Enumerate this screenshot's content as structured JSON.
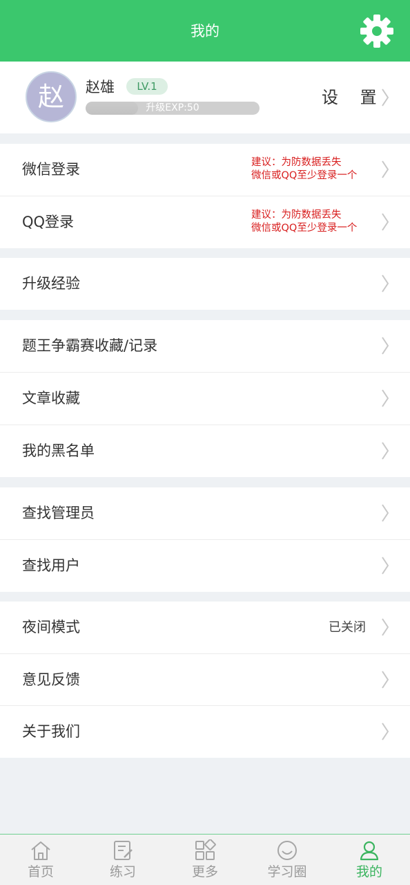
{
  "header": {
    "title": "我的",
    "icon": "gear-icon"
  },
  "profile": {
    "avatar_char": "赵",
    "name": "赵雄",
    "level": "LV.1",
    "exp_text": "升级EXP:50",
    "exp_progress": 0.3,
    "settings_label": "设 置"
  },
  "sections": {
    "wechat_login": {
      "label": "微信登录",
      "hint_line1": "建议：为防数据丢失",
      "hint_line2": "微信或QQ至少登录一个"
    },
    "qq_login": {
      "label": "QQ登录",
      "hint_line1": "建议：为防数据丢失",
      "hint_line2": "微信或QQ至少登录一个"
    },
    "upgrade_exp": {
      "label": "升级经验"
    },
    "contest_favorites": {
      "label": "题王争霸赛收藏/记录"
    },
    "article_favorites": {
      "label": "文章收藏"
    },
    "blacklist": {
      "label": "我的黑名单"
    },
    "find_admin": {
      "label": "查找管理员"
    },
    "find_user": {
      "label": "查找用户"
    },
    "night_mode": {
      "label": "夜间模式",
      "value": "已关闭"
    },
    "feedback": {
      "label": "意见反馈"
    },
    "about": {
      "label": "关于我们"
    }
  },
  "tabbar": {
    "tabs": [
      {
        "label": "首页",
        "icon": "home-icon"
      },
      {
        "label": "练习",
        "icon": "practice-icon"
      },
      {
        "label": "更多",
        "icon": "grid-icon"
      },
      {
        "label": "学习圈",
        "icon": "chat-bubble-icon"
      },
      {
        "label": "我的",
        "icon": "user-icon",
        "active": true
      }
    ]
  },
  "colors": {
    "accent": "#3bc76d",
    "warning": "#d81e1e",
    "background": "#eef1f4"
  }
}
